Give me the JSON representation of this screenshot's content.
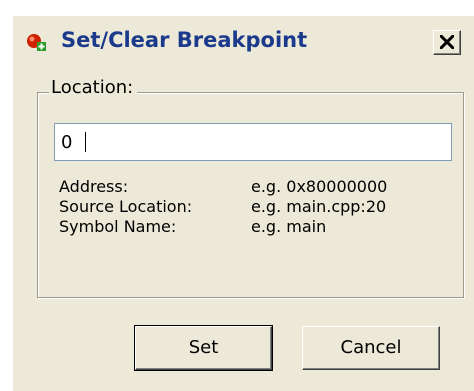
{
  "window": {
    "title": "Set/Clear Breakpoint",
    "title_icon": "breakpoint-icon",
    "close_glyph": "close-icon"
  },
  "location_group": {
    "label": "Location:",
    "input_value": "0",
    "hints": [
      {
        "label": "Address:",
        "example": "e.g.  0x80000000"
      },
      {
        "label": "Source Location:",
        "example": "e.g.  main.cpp:20"
      },
      {
        "label": "Symbol Name:",
        "example": "e.g.  main"
      }
    ]
  },
  "buttons": {
    "set_label": "Set",
    "cancel_label": "Cancel"
  },
  "colors": {
    "title_text": "#1c3a8c",
    "dialog_background": "#ece9d8",
    "icon_red": "#cc2200",
    "icon_green": "#2a9d2a"
  }
}
